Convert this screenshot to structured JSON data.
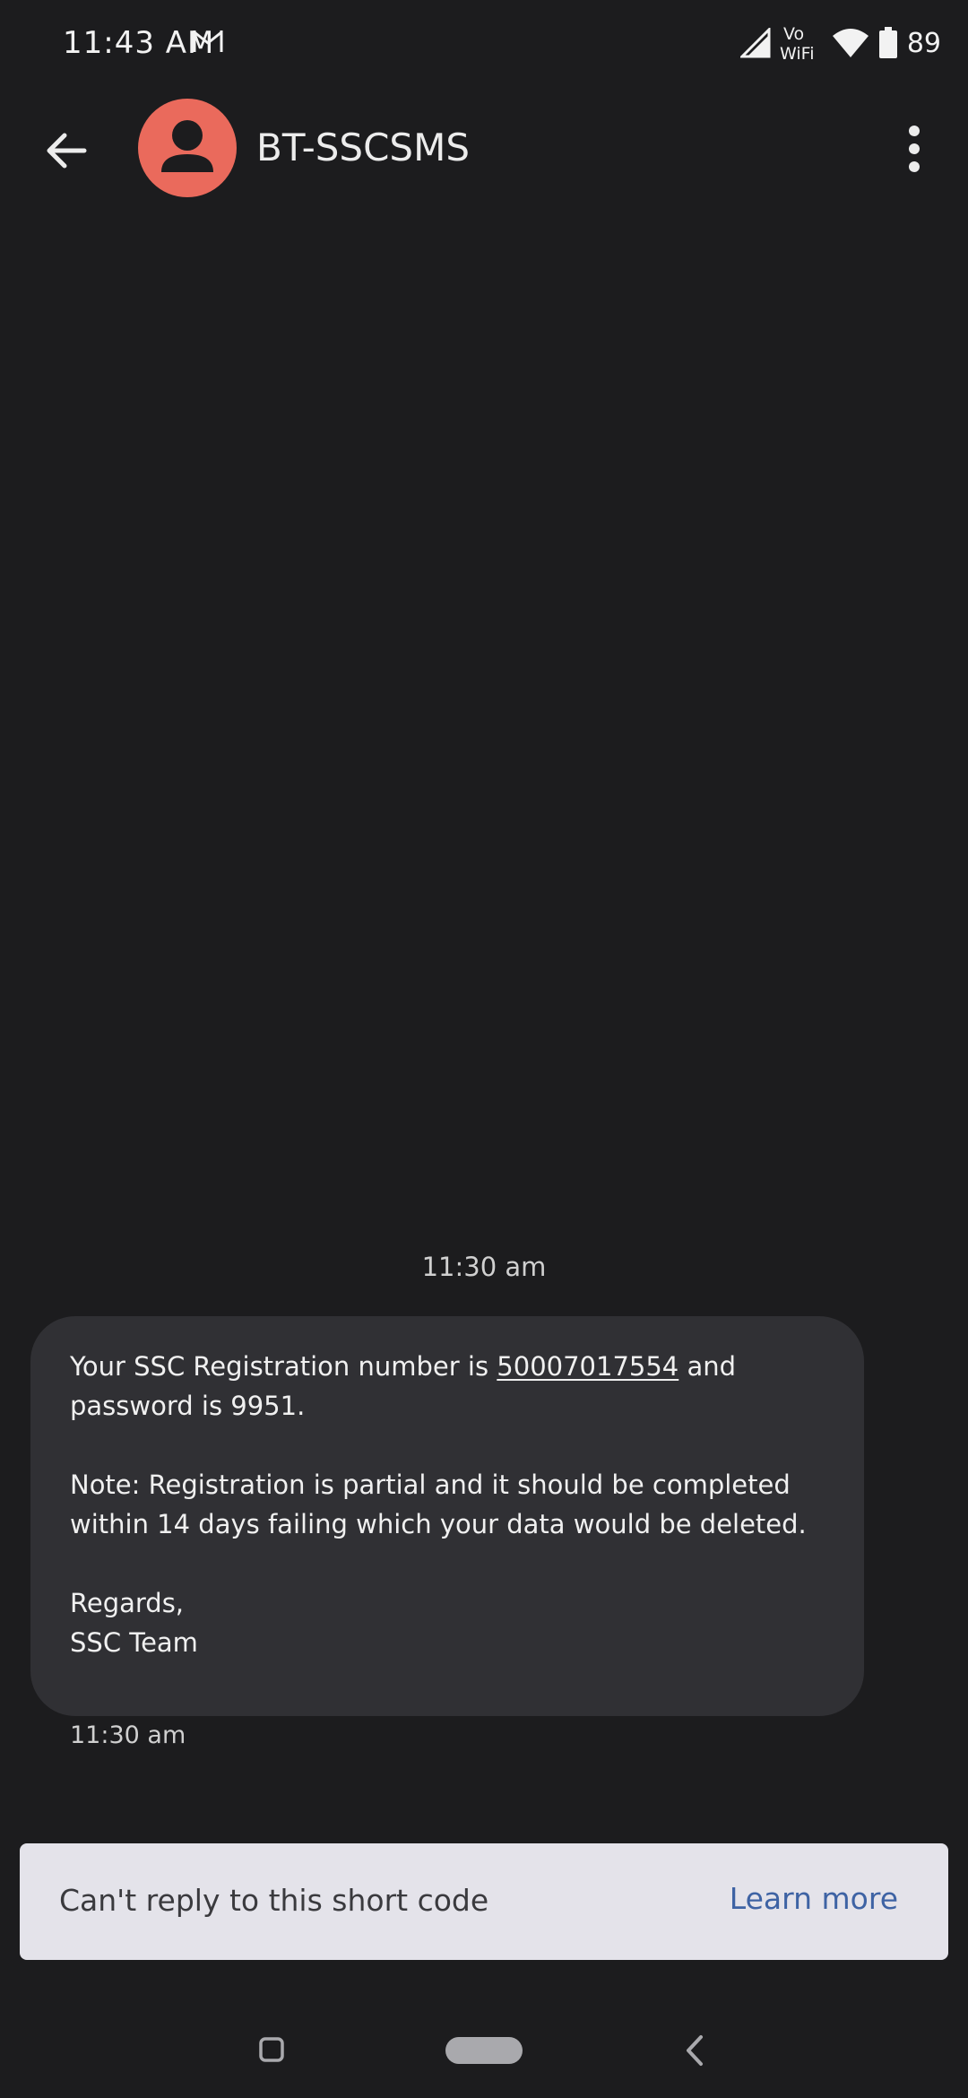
{
  "status_bar": {
    "time": "11:43 AM",
    "wifi_calling": "Vo WiFi",
    "battery": "89",
    "icons": [
      "gmail-icon",
      "signal-icon",
      "vowifi-icon",
      "wifi-icon",
      "battery-icon"
    ]
  },
  "app_bar": {
    "contact_name": "BT-SSCSMS",
    "avatar_color": "#ea6a5c",
    "icons": [
      "back-arrow-icon",
      "person-icon",
      "more-vert-icon"
    ]
  },
  "conversation": {
    "date_header": "11:30 am",
    "message": {
      "line1_prefix": "Your SSC Registration number is ",
      "registration_number": "50007017554",
      "line1_suffix": " and password is 9951.",
      "note": "Note: Registration is partial and it should be completed within 14 days failing which your data would be deleted.",
      "regards": "Regards,",
      "signature": "SSC Team"
    },
    "message_time": "11:30 am"
  },
  "reply_banner": {
    "text": "Can't reply to this short code",
    "action": "Learn more",
    "action_color": "#3e63a4"
  },
  "nav_bar": {
    "icons": [
      "recents-icon",
      "home-pill-icon",
      "back-chevron-icon"
    ]
  }
}
